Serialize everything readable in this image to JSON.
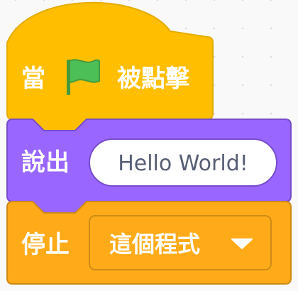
{
  "colors": {
    "events_fill": "#ffbf00",
    "events_stroke": "#e6ac00",
    "looks_fill": "#9966ff",
    "looks_stroke": "#774dcb",
    "control_fill": "#ffab19",
    "control_stroke": "#cf8b17",
    "flag_green": "#4cbf56",
    "flag_dark": "#45993d",
    "field_text": "#575e75"
  },
  "hat_block": {
    "label_before": "當",
    "icon": "green-flag-icon",
    "label_after": "被點擊"
  },
  "say_block": {
    "label": "說出",
    "message": "Hello World!"
  },
  "stop_block": {
    "label": "停止",
    "option": "這個程式",
    "dropdown_icon": "triangle-down-icon"
  }
}
